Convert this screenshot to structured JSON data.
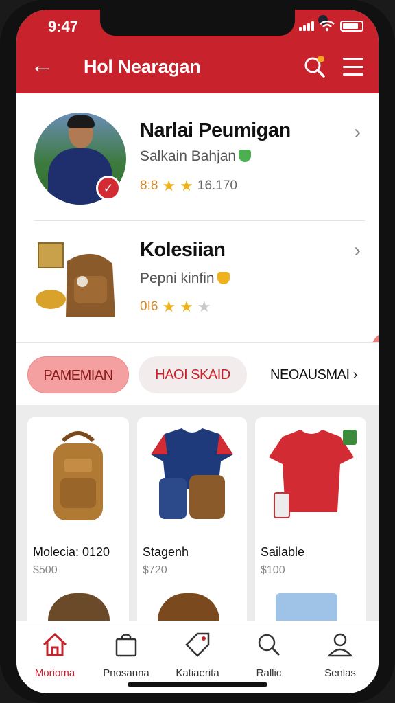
{
  "status_bar": {
    "time": "9:47"
  },
  "header": {
    "title": "Hol Nearagan"
  },
  "cards": [
    {
      "name": "Narlai Peumigan",
      "subtitle": "Salkain Bahjan",
      "rating_value": "8:8",
      "stars": 2,
      "count": "16.170",
      "badge_color": "#4caf50"
    },
    {
      "name": "Kolesiian",
      "subtitle": "Pepni kinfin",
      "rating_value": "0I6",
      "stars": 2,
      "count": "",
      "badge_color": "#f0b21c"
    }
  ],
  "tabs": [
    {
      "label": "PAMEMIAN",
      "active": true
    },
    {
      "label": "HAOI SKAID",
      "active": false
    },
    {
      "label": "NEOAUSMAI",
      "active": false
    }
  ],
  "products": [
    {
      "name": "Molecia: 0120",
      "price": "$500",
      "image": "brown-backpack"
    },
    {
      "name": "Stagenh",
      "price": "$720",
      "image": "jersey-and-bags"
    },
    {
      "name": "Sailable",
      "price": "$100",
      "image": "red-jersey"
    }
  ],
  "bottom_nav": [
    {
      "label": "Morioma",
      "icon": "home-icon",
      "active": true
    },
    {
      "label": "Pnosanna",
      "icon": "bag-icon",
      "active": false
    },
    {
      "label": "Katiaerita",
      "icon": "tag-icon",
      "active": false
    },
    {
      "label": "Rallic",
      "icon": "search-icon",
      "active": false
    },
    {
      "label": "Senlas",
      "icon": "user-icon",
      "active": false
    }
  ],
  "colors": {
    "accent": "#c8232c",
    "tab_active": "#f4a0a0"
  }
}
